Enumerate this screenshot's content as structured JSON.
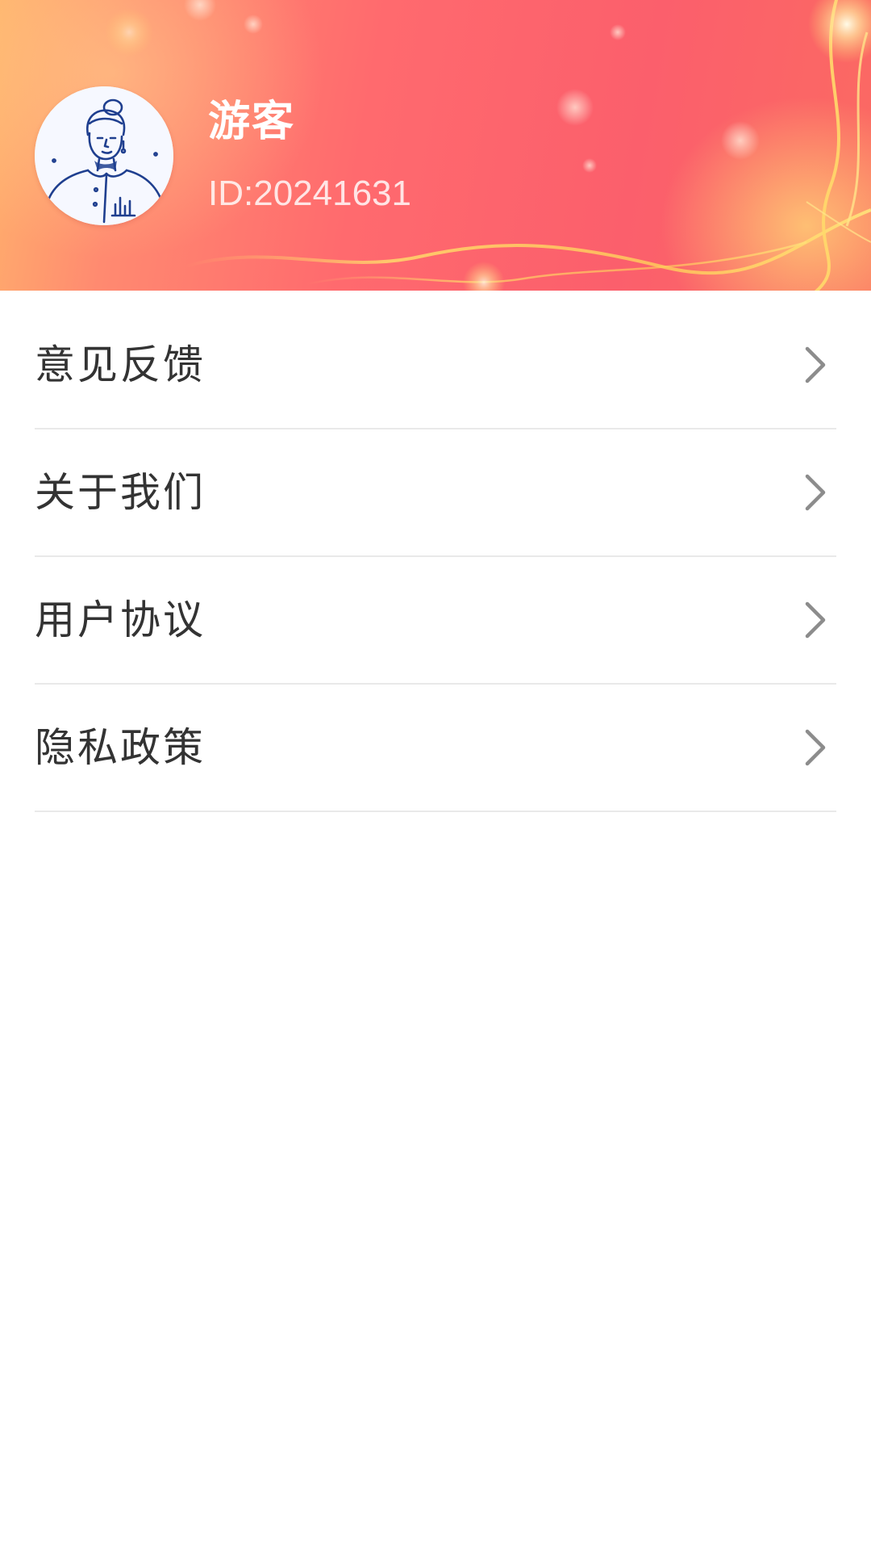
{
  "profile": {
    "name": "游客",
    "id_text": "ID:20241631",
    "avatar_icon": "user-avatar-illustration-icon"
  },
  "menu": {
    "items": [
      {
        "label": "意见反馈",
        "icon": "chevron-right-icon"
      },
      {
        "label": "关于我们",
        "icon": "chevron-right-icon"
      },
      {
        "label": "用户协议",
        "icon": "chevron-right-icon"
      },
      {
        "label": "隐私政策",
        "icon": "chevron-right-icon"
      }
    ]
  },
  "colors": {
    "header_gradient_start": "#ffb36c",
    "header_gradient_mid": "#ff6a6e",
    "header_gradient_end": "#fb5f6c",
    "divider": "#e9e9e9",
    "menu_text": "#333333",
    "chevron": "#8c8c8c"
  }
}
